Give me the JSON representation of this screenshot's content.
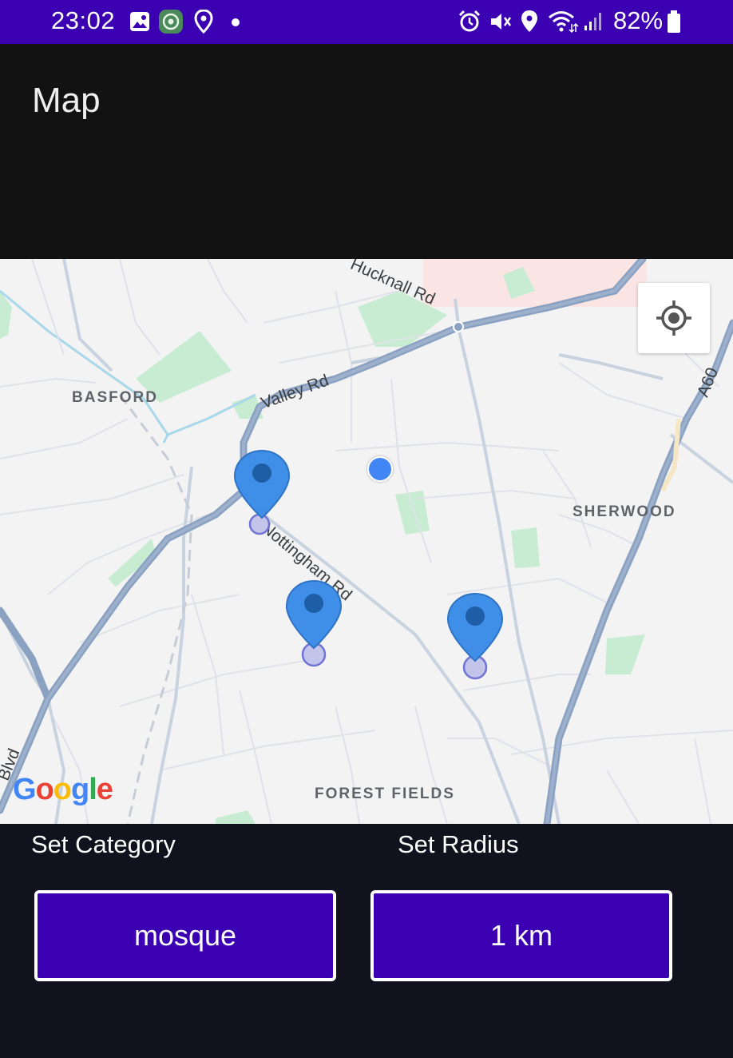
{
  "status_bar": {
    "time": "23:02",
    "battery": "82%",
    "icons": [
      "gallery-icon",
      "app-icon",
      "location-icon",
      "dot-icon",
      "alarm-icon",
      "mute-icon",
      "location-icon",
      "wifi-icon",
      "signal-icon",
      "battery-icon"
    ]
  },
  "app_bar": {
    "title": "Map"
  },
  "map": {
    "areas": [
      "BASFORD",
      "SHERWOOD",
      "FOREST FIELDS"
    ],
    "roads": [
      "Hucknall Rd",
      "Valley Rd",
      "Nottingham Rd",
      "A60",
      "Blvd"
    ],
    "attribution": "Google"
  },
  "controls": {
    "category_label": "Set Category",
    "category_value": "mosque",
    "radius_label": "Set Radius",
    "radius_value": "1 km"
  },
  "colors": {
    "status_bar": "#3b00b2",
    "app_bar": "#121212",
    "button": "#3b00b2",
    "marker": "#3f8ee8",
    "user_location": "#4285f4"
  }
}
